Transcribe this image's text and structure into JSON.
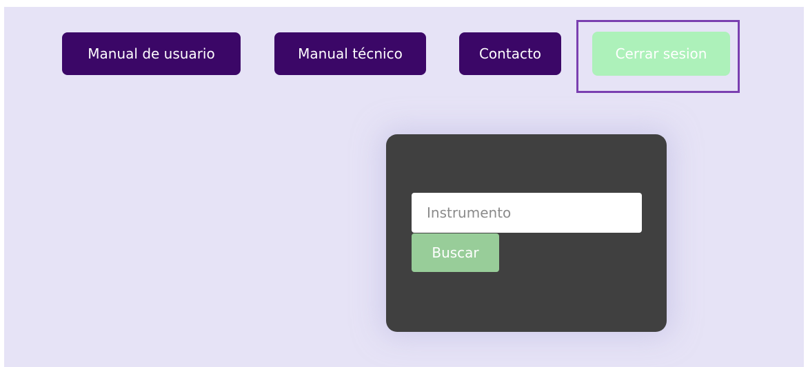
{
  "nav": {
    "manual_usuario_label": "Manual de usuario",
    "manual_tecnico_label": "Manual técnico",
    "contacto_label": "Contacto",
    "cerrar_sesion_label": "Cerrar sesion"
  },
  "search": {
    "placeholder": "Instrumento",
    "value": "",
    "button_label": "Buscar"
  },
  "colors": {
    "page_background": "#e6e3f6",
    "nav_button": "#3b0767",
    "logout_button": "#adf1ba",
    "logout_highlight_border": "#7a3fb0",
    "card_background": "#404040",
    "search_button": "#98cd99"
  }
}
